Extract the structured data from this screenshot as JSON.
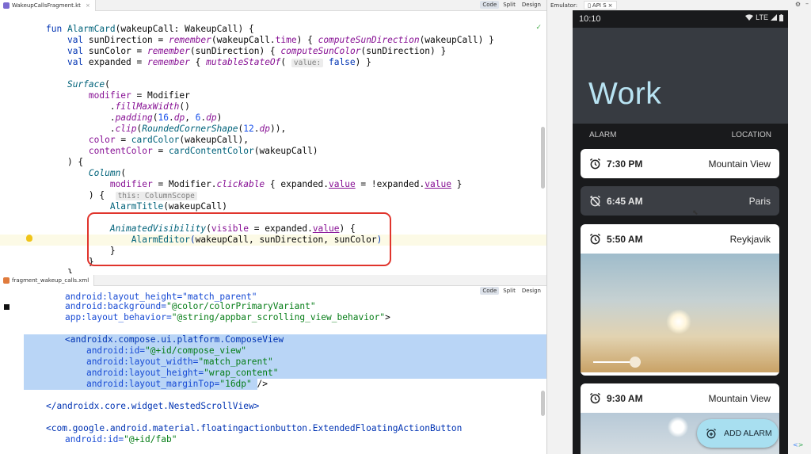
{
  "editor_top": {
    "file_tab": "WakeupCallsFragment.kt",
    "modes": [
      "Code",
      "Split",
      "Design"
    ],
    "hints": {
      "value": "value:",
      "scope": "this: ColumnScope"
    }
  },
  "editor_bottom": {
    "file_tab": "fragment_wakeup_calls.xml",
    "modes": [
      "Code",
      "Split",
      "Design"
    ]
  },
  "emulator": {
    "label": "Emulator:",
    "device": "API S"
  },
  "phone": {
    "time": "10:10",
    "network": "LTE",
    "title": "Work",
    "column_alarm": "ALARM",
    "column_location": "LOCATION",
    "alarms": [
      {
        "time": "7:30 PM",
        "place": "Mountain View",
        "enabled": true
      },
      {
        "time": "6:45 AM",
        "place": "Paris",
        "enabled": false
      },
      {
        "time": "5:50 AM",
        "place": "Reykjavik",
        "enabled": true,
        "expanded": true
      },
      {
        "time": "9:30 AM",
        "place": "Mountain View",
        "enabled": true,
        "expanded": true
      }
    ],
    "fab_label": "ADD ALARM"
  },
  "colors": {
    "highlight_box": "#e0342c",
    "selection": "#b9d5f6",
    "app_bar": "#373b41",
    "title": "#b8e3f2",
    "fab": "#a8dff0"
  }
}
